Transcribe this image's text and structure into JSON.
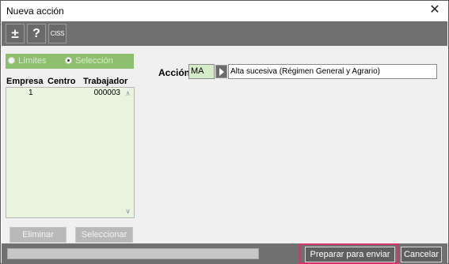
{
  "window": {
    "title": "Nueva acción"
  },
  "toolbar": {
    "plus_minus_label": "±",
    "help_label": "?",
    "ciss_label": "CISS"
  },
  "selection_mode": {
    "options": [
      {
        "label": "Límites",
        "selected": false
      },
      {
        "label": "Selección",
        "selected": true
      }
    ]
  },
  "list": {
    "headers": [
      "Empresa",
      "Centro",
      "Trabajador"
    ],
    "rows": [
      {
        "empresa": "1",
        "centro": "",
        "trabajador": "000003"
      }
    ]
  },
  "list_buttons": {
    "eliminar": "Eliminar",
    "seleccionar": "Seleccionar"
  },
  "accion": {
    "label": "Acción",
    "code": "MA",
    "description": "Alta sucesiva (Régimen General y Agrario)"
  },
  "footer": {
    "preparar": "Preparar para enviar",
    "cancelar": "Cancelar"
  },
  "colors": {
    "toolbar_bg": "#707070",
    "radio_bar": "#8dbf6e",
    "list_bg": "#e8f3e0",
    "highlight": "#d6336c"
  }
}
